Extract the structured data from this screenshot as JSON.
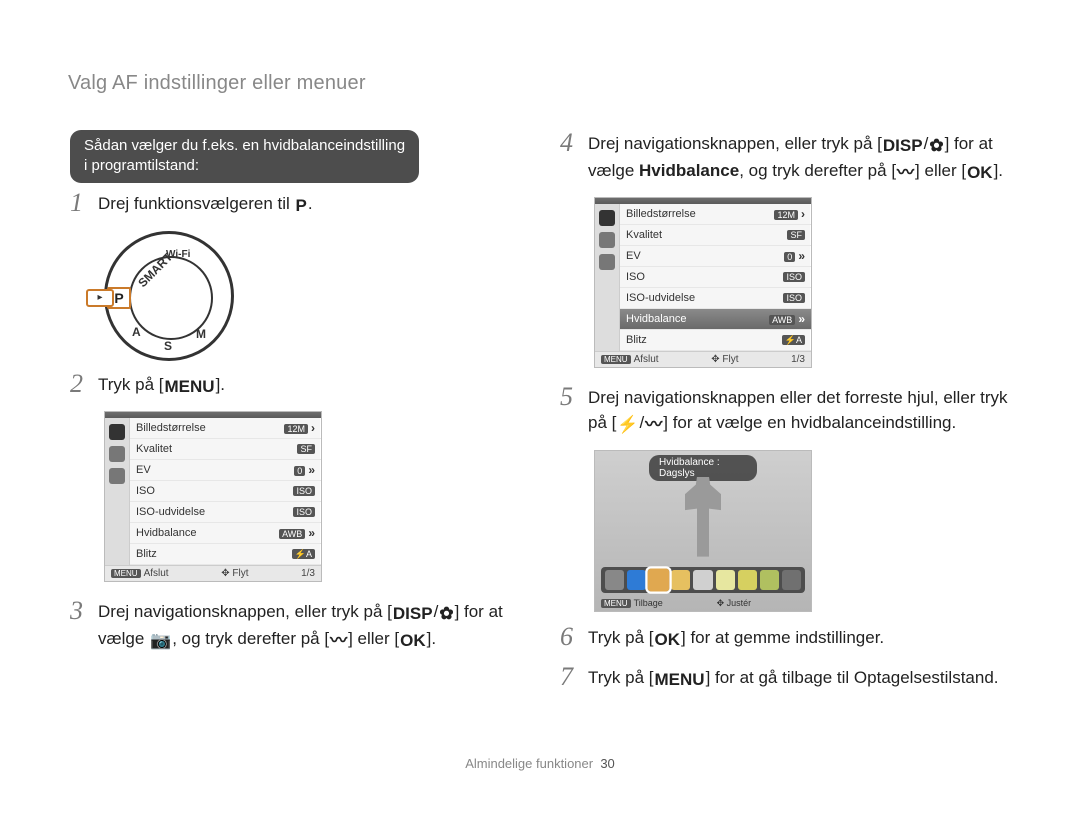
{
  "page_title": "Valg AF indstillinger eller menuer",
  "intro_pill_line1": "Sådan vælger du f.eks. en hvidbalanceindstilling",
  "intro_pill_line2": "i programtilstand:",
  "steps": {
    "s1": {
      "num": "1",
      "text_a": "Drej funktionsvælgeren til ",
      "icon": "P",
      "text_b": "."
    },
    "s2": {
      "num": "2",
      "text_a": "Tryk på [",
      "icon": "MENU",
      "text_b": "]."
    },
    "s3": {
      "num": "3",
      "text_a": "Drej navigationsknappen, eller tryk på [",
      "icon1": "DISP",
      "sep": "/",
      "icon2": "✿",
      "text_b": "] for at vælge ",
      "icon3": "📷",
      "text_c": ", og tryk derefter på [",
      "icon4": "〰",
      "text_d": "] eller [",
      "icon5": "OK",
      "text_e": "]."
    },
    "s4": {
      "num": "4",
      "text_a": "Drej navigationsknappen, eller tryk på [",
      "icon1": "DISP",
      "sep": "/",
      "icon2": "✿",
      "text_b": "] for at vælge ",
      "bold": "Hvidbalance",
      "text_c": ", og tryk derefter på [",
      "icon3": "〰",
      "text_d": "] eller [",
      "icon4": "OK",
      "text_e": "]."
    },
    "s5": {
      "num": "5",
      "text_a": "Drej navigationsknappen eller det forreste hjul, eller tryk på [",
      "icon1": "⚡",
      "sep": "/",
      "icon2": "〰",
      "text_b": "] for at vælge en hvidbalanceindstilling."
    },
    "s6": {
      "num": "6",
      "text_a": "Tryk på [",
      "icon": "OK",
      "text_b": "] for at gemme indstillinger."
    },
    "s7": {
      "num": "7",
      "text_a": "Tryk på [",
      "icon": "MENU",
      "text_b": "] for at gå tilbage til Optagelsestilstand."
    }
  },
  "dial": {
    "labels": {
      "smart": "SMART",
      "wifi": "Wi-Fi",
      "P": "P",
      "A": "A",
      "S": "S",
      "M": "M"
    },
    "pointer": "▸"
  },
  "menu": {
    "items": [
      {
        "label": "Billedstørrelse",
        "val": "12M",
        "arrow": true
      },
      {
        "label": "Kvalitet",
        "val": "SF"
      },
      {
        "label": "EV",
        "val": "0",
        "dblarrow": true
      },
      {
        "label": "ISO",
        "val": "ISO"
      },
      {
        "label": "ISO-udvidelse",
        "val": "ISO"
      },
      {
        "label": "Hvidbalance",
        "val": "AWB",
        "dblarrow": true
      },
      {
        "label": "Blitz",
        "val": "⚡A"
      }
    ],
    "footer": {
      "left_btn": "MENU",
      "left": "Afslut",
      "mid_icon": "✥",
      "mid": "Flyt",
      "page": "1/3"
    }
  },
  "menu_selected_index": 5,
  "wb_screen": {
    "title": "Hvidbalance : Dagslys",
    "footer": {
      "left_btn": "MENU",
      "left": "Tilbage",
      "mid_icon": "✥",
      "mid": "Justér"
    },
    "swatches": [
      "#888",
      "#2e7bd6",
      "#e0a850",
      "#e6c060",
      "#d0d0d0",
      "#e7e7a0",
      "#d6d060",
      "#b0c060",
      "#707070"
    ]
  },
  "footer": {
    "label": "Almindelige funktioner",
    "page": "30"
  }
}
